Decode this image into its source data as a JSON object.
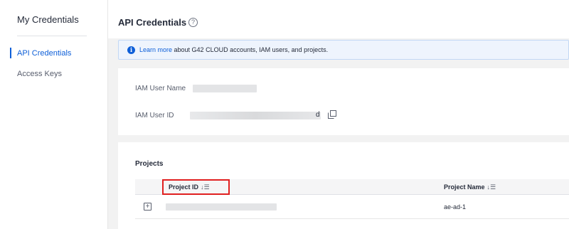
{
  "sidebar": {
    "title": "My Credentials",
    "items": [
      {
        "label": "API Credentials",
        "active": true
      },
      {
        "label": "Access Keys",
        "active": false
      }
    ]
  },
  "header": {
    "title": "API Credentials",
    "help_icon": "question-circle-icon"
  },
  "info_bar": {
    "link_text": "Learn more",
    "text": " about G42 CLOUD accounts, IAM users, and projects.",
    "icon": "info-circle-icon"
  },
  "user_info": {
    "name_label": "IAM User Name",
    "id_label": "IAM User ID",
    "id_suffix": "d",
    "copy_icon": "copy-icon"
  },
  "projects": {
    "title": "Projects",
    "columns": [
      {
        "label": "Project ID",
        "sort_icon": "↓☰"
      },
      {
        "label": "Project Name",
        "sort_icon": "↓☰"
      }
    ],
    "rows": [
      {
        "project_name": "ae-ad-1"
      }
    ]
  },
  "colors": {
    "accent": "#0e5fd8",
    "highlight": "#e02020"
  }
}
